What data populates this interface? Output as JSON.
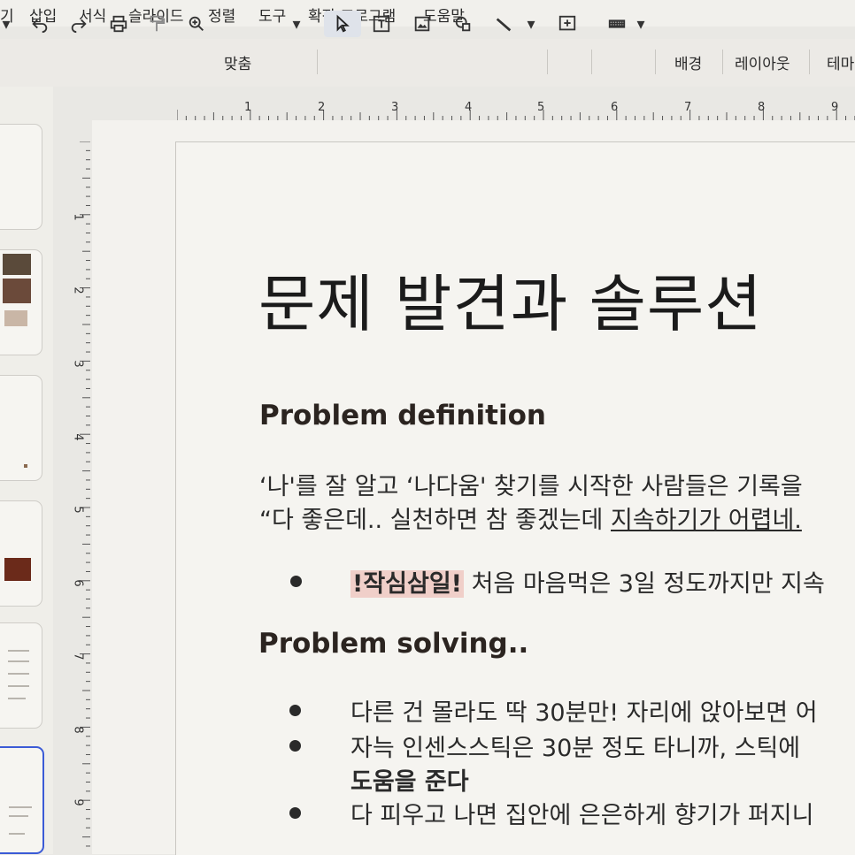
{
  "menu": [
    "기",
    "삽입",
    "서식",
    "슬라이드",
    "정렬",
    "도구",
    "확장 프로그램",
    "도움말"
  ],
  "toolbar": {
    "zoom_label": "맞춤",
    "background_button": "배경",
    "layout_button": "레이아웃",
    "theme_button": "테마"
  },
  "ruler": {
    "horizontal": [
      "1",
      "2",
      "3",
      "4",
      "5",
      "6",
      "7",
      "8",
      "9"
    ],
    "vertical": [
      "1",
      "2",
      "3",
      "4",
      "5",
      "6",
      "7",
      "8",
      "9"
    ]
  },
  "slide": {
    "title": "문제 발견과 솔루션",
    "problem_heading": "Problem definition",
    "problem_line1": "‘나'를 잘 알고 ‘나다움' 찾기를 시작한 사람들은 기록을",
    "problem_line2_a": "“다 좋은데.. 실천하면 참 좋겠는데 ",
    "problem_line2_b": "지속하기가 어렵네.",
    "bullet1_highlight": "!작심삼일!",
    "bullet1_text": " 처음 마음먹은 3일 정도까지만 지속",
    "solving_heading": "Problem solving..",
    "solving_bullets": [
      "다른 건 몰라도 딱 30분만! 자리에 앉아보면 어",
      "자늑 인센스스틱은 30분 정도 타니까, 스틱에",
      "도움을 준다",
      "다 피우고 나면 집안에 은은하게 향기가 퍼지니"
    ]
  },
  "colors": {
    "highlight": "#f0cfc9",
    "active_thumb_border": "#3b5bd6"
  }
}
